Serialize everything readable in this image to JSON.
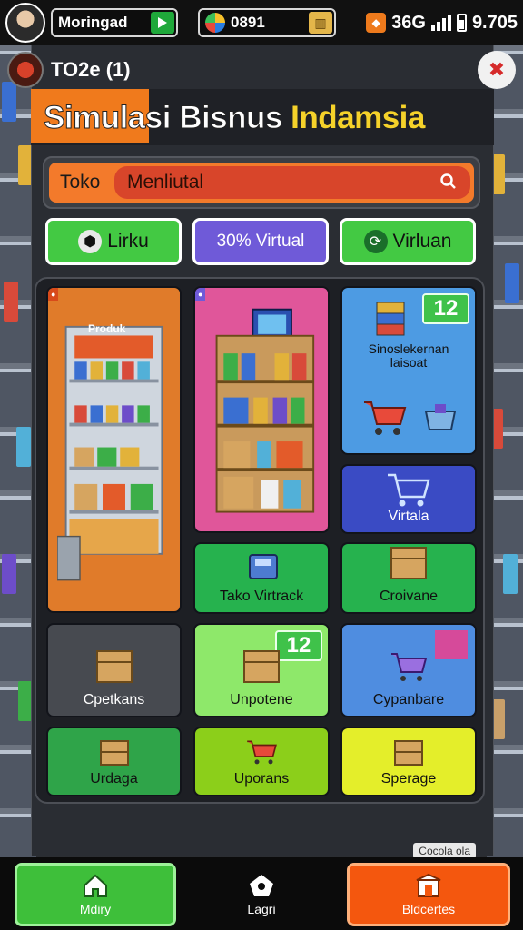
{
  "status_bar": {
    "player_name": "Moringad",
    "currency_value": "0891",
    "system_text": "9.705",
    "signal_text": "36G"
  },
  "header": {
    "store_id": "TO2e (1)",
    "title_part1": "Simulasi",
    "title_part2": "Bisnus",
    "title_part3": "Indamsia"
  },
  "search": {
    "label": "Toko",
    "value": "Menliutal"
  },
  "tabs": [
    {
      "label": "Lirku",
      "icon": "box-icon"
    },
    {
      "label": "30% Virtual",
      "icon": ""
    },
    {
      "label": "Virluan",
      "icon": "refresh-icon"
    }
  ],
  "cards": {
    "shelf_large_tag": "Produk",
    "info_card_text1": "Sinoslekernan",
    "info_card_text2": "laisoat",
    "info_badge": "12",
    "virtual_card": "Virtala",
    "tako_card": "Tako Virtrack",
    "croivane_card": "Croivane",
    "cpetkans_card": "Cpetkans",
    "unpolene_card": "Unpotene",
    "unpolene_badge": "12",
    "cyganbare_card": "Cypanbare",
    "urdaga_card": "Urdaga",
    "upprans_card": "Uporans",
    "sperade_card": "Sperage"
  },
  "footer": {
    "version": "Cocola ola",
    "nav_home": "Mdiry",
    "nav_center": "Lagri",
    "nav_right": "Bldcertes"
  },
  "colors": {
    "accent_orange": "#f07a1c",
    "title_yellow": "#f5d22a",
    "green": "#43c943",
    "purple": "#6f5ad8",
    "blue": "#4f8de0"
  }
}
